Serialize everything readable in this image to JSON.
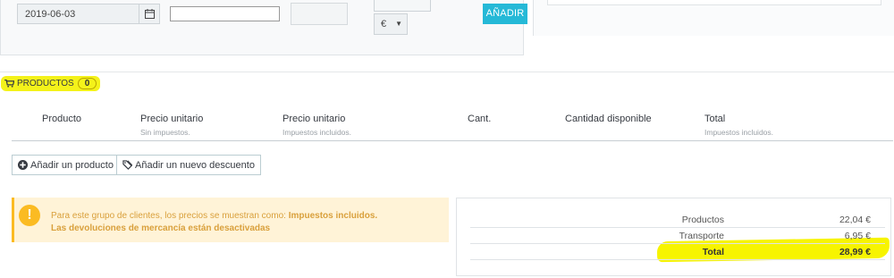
{
  "toolbar": {
    "date_value": "2019-06-03",
    "text_value": "",
    "currency": "€",
    "add_label": "AÑADIR"
  },
  "products_section": {
    "title": "PRODUCTOS",
    "count": "0"
  },
  "table": {
    "columns": [
      {
        "label": "Producto",
        "sub": ""
      },
      {
        "label": "Precio unitario",
        "sub": "Sin impuestos."
      },
      {
        "label": "Precio unitario",
        "sub": "Impuestos incluidos."
      },
      {
        "label": "Cant.",
        "sub": ""
      },
      {
        "label": "Cantidad disponible",
        "sub": ""
      },
      {
        "label": "Total",
        "sub": "Impuestos incluidos."
      }
    ]
  },
  "actions": {
    "add_product": "Añadir un producto",
    "add_discount": "Añadir un nuevo descuento"
  },
  "alert": {
    "line1_prefix": "Para este grupo de clientes, los precios se muestran como: ",
    "line1_bold": "Impuestos incluidos.",
    "line2": "Las devoluciones de mercancía están desactivadas"
  },
  "summary": {
    "rows": [
      {
        "label": "Productos",
        "value": "22,04 €"
      },
      {
        "label": "Transporte",
        "value": "6,95 €"
      },
      {
        "label": "Total",
        "value": "28,99 €"
      }
    ]
  },
  "colors": {
    "accent": "#25b9d7",
    "highlight": "#f4f21a",
    "warning": "#fbbb22"
  }
}
